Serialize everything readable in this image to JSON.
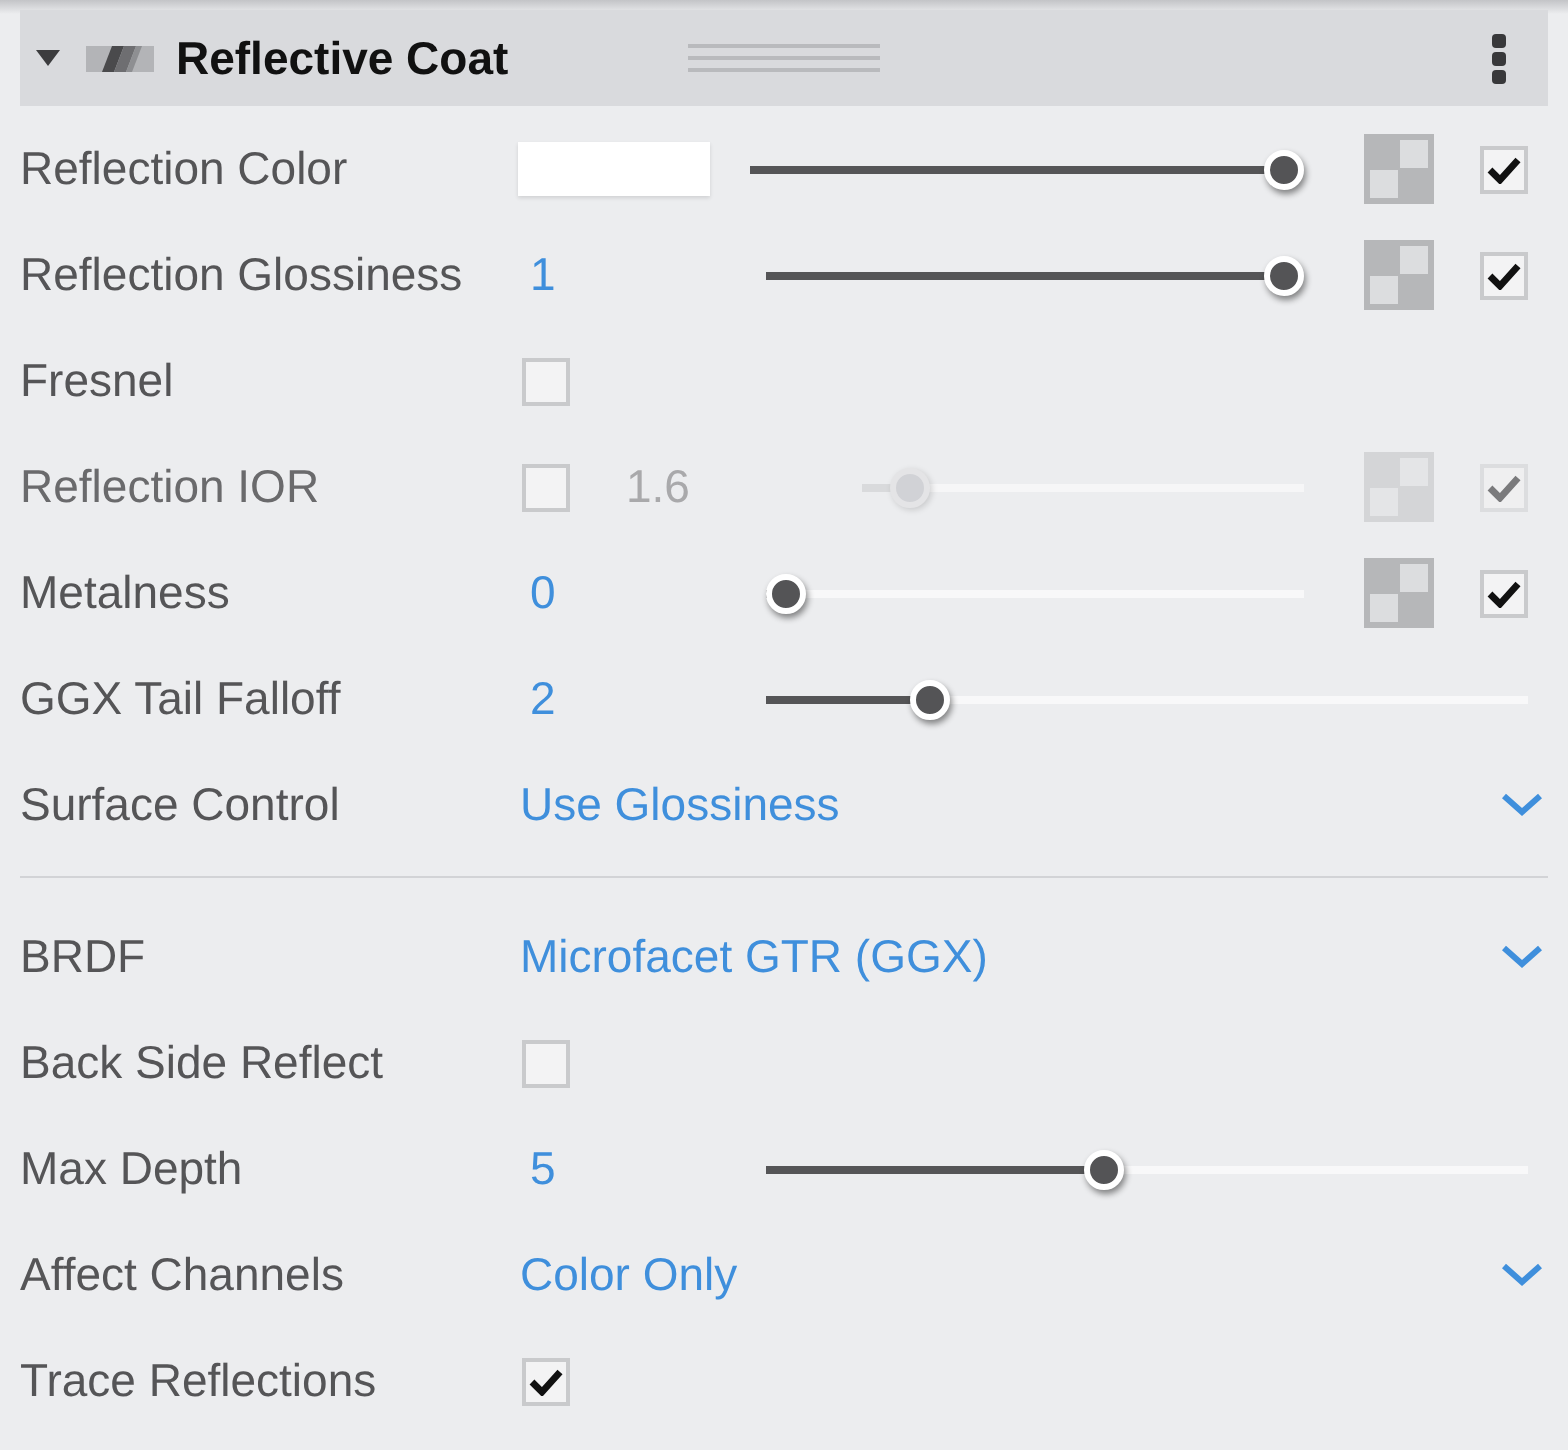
{
  "panel": {
    "title": "Reflective Coat",
    "expanded": true
  },
  "sections": [
    {
      "rows": [
        {
          "kind": "color",
          "label": "Reflection Color",
          "disabled": false,
          "color": "#ffffff",
          "level": 1,
          "map": {
            "checked": true
          }
        },
        {
          "kind": "slider",
          "label": "Reflection Glossiness",
          "disabled": false,
          "value": "1",
          "level": 1,
          "map": {
            "checked": true
          }
        },
        {
          "kind": "checkbox",
          "label": "Fresnel",
          "disabled": false,
          "checked": false
        },
        {
          "kind": "slider",
          "label": "Reflection IOR",
          "disabled": true,
          "toggle": {
            "checked": false
          },
          "value": "1.6",
          "level": 0.07,
          "map": {
            "checked": true
          }
        },
        {
          "kind": "slider",
          "label": "Metalness",
          "disabled": false,
          "value": "0",
          "level": 0,
          "map": {
            "checked": true
          }
        },
        {
          "kind": "slider",
          "label": "GGX Tail Falloff",
          "disabled": false,
          "value": "2",
          "level": 0.2
        },
        {
          "kind": "dropdown",
          "label": "Surface Control",
          "disabled": false,
          "value": "Use Glossiness"
        }
      ]
    },
    {
      "rows": [
        {
          "kind": "dropdown",
          "label": "BRDF",
          "disabled": false,
          "value": "Microfacet GTR (GGX)"
        },
        {
          "kind": "checkbox",
          "label": "Back Side Reflect",
          "disabled": false,
          "checked": false
        },
        {
          "kind": "slider",
          "label": "Max Depth",
          "disabled": false,
          "value": "5",
          "level": 0.44
        },
        {
          "kind": "dropdown",
          "label": "Affect Channels",
          "disabled": false,
          "value": "Color Only"
        },
        {
          "kind": "checkbox",
          "label": "Trace Reflections",
          "disabled": false,
          "checked": true
        }
      ]
    }
  ]
}
